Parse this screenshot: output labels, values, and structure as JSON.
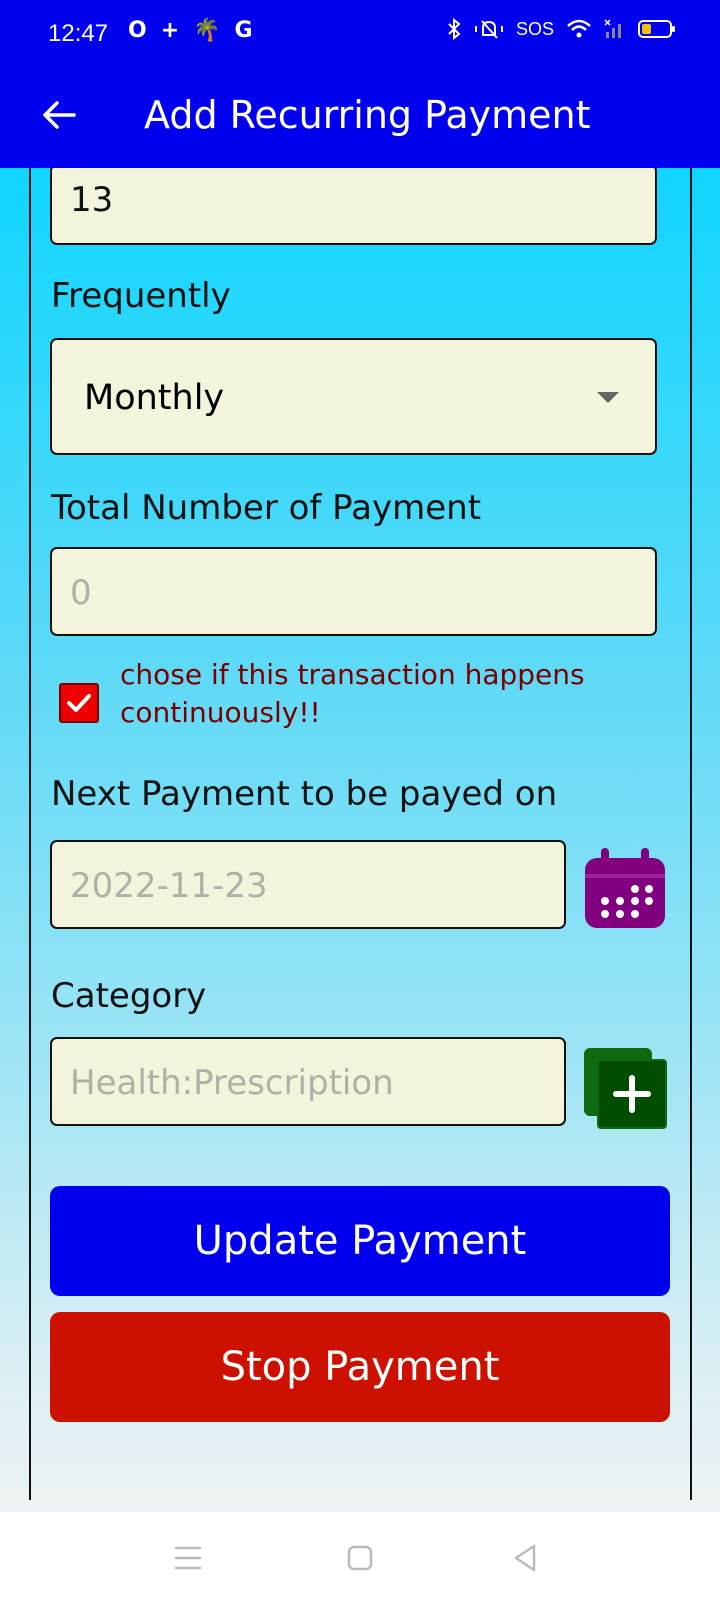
{
  "status_bar": {
    "time": "12:47",
    "left_icons": [
      "O",
      "+",
      "🌴",
      "G"
    ],
    "sos": "SOS",
    "battery_color": "#f2c200"
  },
  "header": {
    "title": "Add Recurring Payment",
    "back_icon": "arrow-left-icon",
    "background": "#0000ee"
  },
  "form": {
    "amount_value": "13",
    "frequency_label": "Frequently",
    "frequency_selected": "Monthly",
    "total_payments_label": "Total Number of Payment",
    "total_payments_placeholder": "0",
    "continuous_checked": true,
    "continuous_text": "chose if this transaction happens continuously!!",
    "next_payment_label": "Next Payment to be payed on",
    "next_payment_placeholder": "2022-11-23",
    "calendar_icon": "calendar-icon",
    "category_label": "Category",
    "category_placeholder": "Health:Prescription",
    "add_category_icon": "add-category-icon"
  },
  "buttons": {
    "update_label": "Update Payment",
    "stop_label": "Stop Payment",
    "update_color": "#0000ee",
    "stop_color": "#cc1100"
  },
  "nav_bar": {
    "menu_icon": "menu-icon",
    "home_icon": "home-square-icon",
    "back_icon": "back-triangle-icon"
  }
}
